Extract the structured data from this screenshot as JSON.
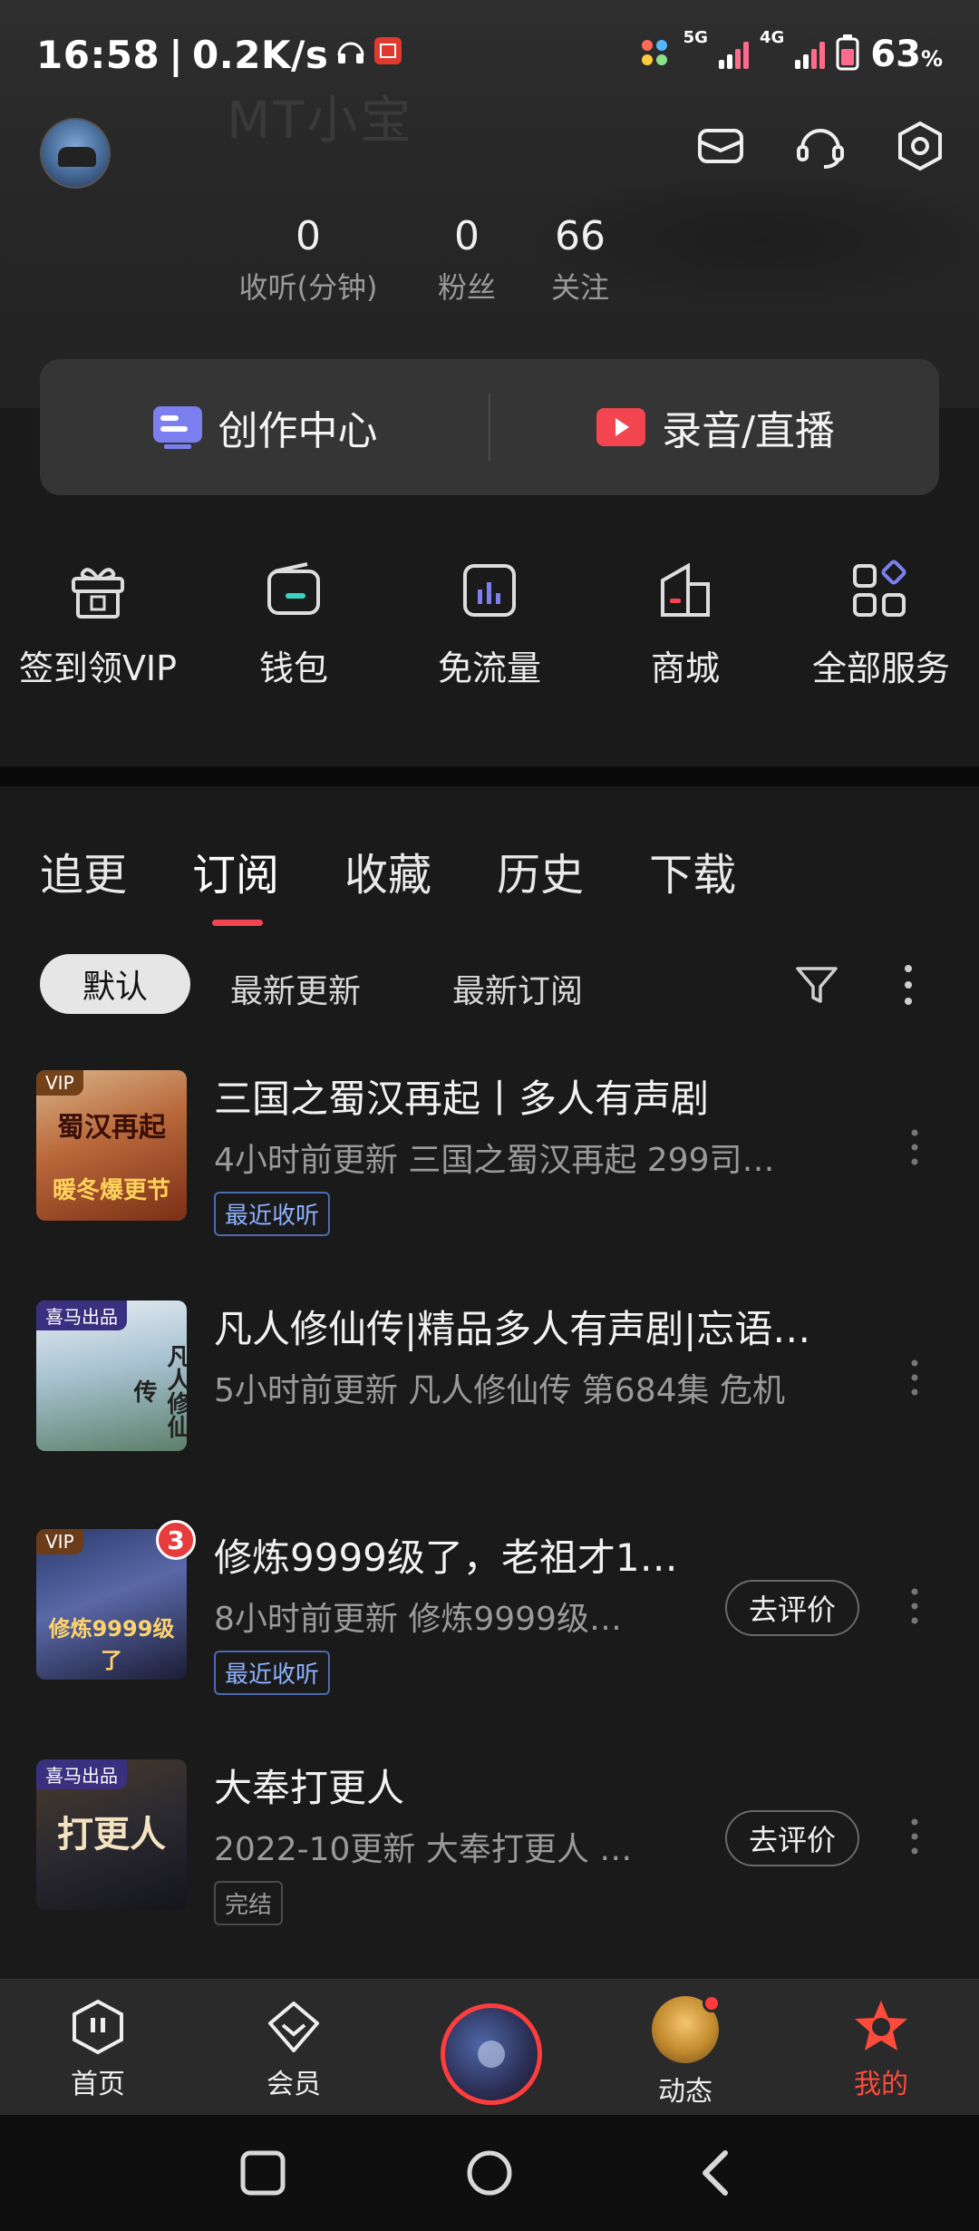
{
  "status_bar": {
    "time": "16:58",
    "network_speed": "0.2K/s",
    "sim1_label": "5G",
    "sim2_label": "4G",
    "battery_percent": "63"
  },
  "header": {
    "ghost_username": "MT小宝",
    "icons": [
      "mail-icon",
      "headset-icon",
      "settings-icon"
    ]
  },
  "stats": [
    {
      "value": "0",
      "label": "收听(分钟)"
    },
    {
      "value": "0",
      "label": "粉丝"
    },
    {
      "value": "66",
      "label": "关注"
    }
  ],
  "create_card": {
    "creator_center": "创作中心",
    "record_live": "录音/直播"
  },
  "services": [
    {
      "label": "签到领VIP",
      "icon": "gift-sign-icon"
    },
    {
      "label": "钱包",
      "icon": "wallet-icon"
    },
    {
      "label": "免流量",
      "icon": "data-free-icon"
    },
    {
      "label": "商城",
      "icon": "mall-icon"
    },
    {
      "label": "全部服务",
      "icon": "all-services-icon"
    }
  ],
  "tabs": [
    {
      "label": "追更",
      "active": false
    },
    {
      "label": "订阅",
      "active": true
    },
    {
      "label": "收藏",
      "active": false
    },
    {
      "label": "历史",
      "active": false
    },
    {
      "label": "下载",
      "active": false
    }
  ],
  "filters": {
    "selected": "默认",
    "options": [
      "最新更新",
      "最新订阅"
    ]
  },
  "items": [
    {
      "title": "三国之蜀汉再起丨多人有声剧",
      "subtitle": "4小时前更新   三国之蜀汉再起 299司…",
      "tag": "最近收听",
      "cover_label": "VIP",
      "cover_text": "蜀汉再起",
      "cover_text2": "暖冬爆更节"
    },
    {
      "title": "凡人修仙传|精品多人有声剧|忘语…",
      "subtitle": "5小时前更新   凡人修仙传 第684集 危机",
      "tag": "",
      "cover_label": "喜马出品",
      "cover_text": "凡人修仙传",
      "cover_text2": ""
    },
    {
      "title": "修炼9999级了，老祖才1…",
      "subtitle": "8小时前更新   修炼9999级…",
      "tag": "最近收听",
      "cover_label": "VIP",
      "cover_text": "修炼9999级了",
      "cover_text2": "",
      "badge": "3",
      "action": "去评价"
    },
    {
      "title": "大奉打更人",
      "subtitle": "2022-10更新   大奉打更人 …",
      "tag": "完结",
      "cover_label": "喜马出品",
      "cover_text": "打更人",
      "cover_text2": "",
      "action": "去评价"
    }
  ],
  "bottom_nav": [
    {
      "label": "首页",
      "active": false
    },
    {
      "label": "会员",
      "active": false
    },
    {
      "label": "",
      "active": false
    },
    {
      "label": "动态",
      "active": false
    },
    {
      "label": "我的",
      "active": true
    }
  ],
  "colors": {
    "accent": "#f2454f",
    "active_nav": "#ff4b3a",
    "tag_blue": "#8db2ff"
  }
}
